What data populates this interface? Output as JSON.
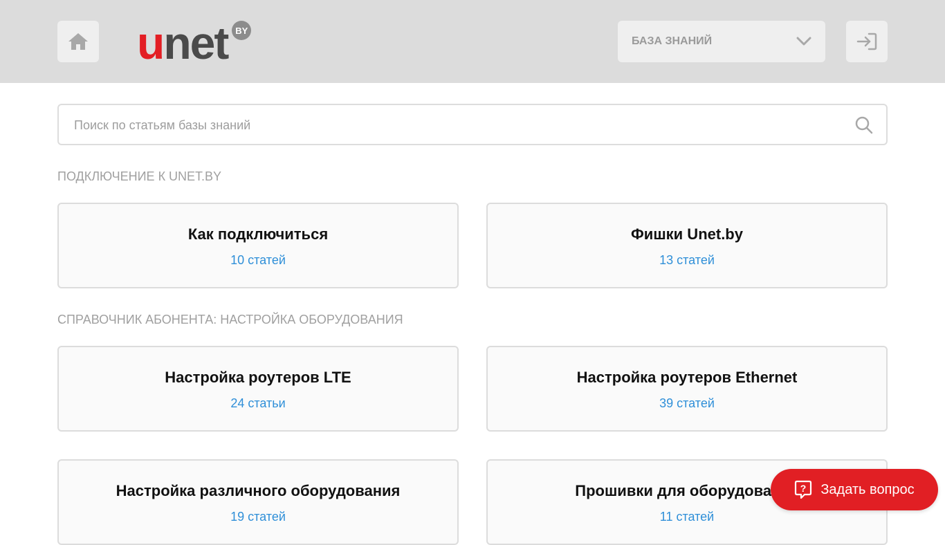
{
  "header": {
    "home_icon": "home-icon",
    "logo": {
      "part1": "u",
      "part2": "net",
      "badge": "BY",
      "colors": {
        "u": "#e31e24",
        "net": "#4a4a4a",
        "badge": "#8c8c8c"
      }
    },
    "kb_select_label": "БАЗА ЗНАНИЙ",
    "kb_select_icon": "chevron-down-icon",
    "login_icon": "login-icon"
  },
  "search": {
    "placeholder": "Поиск по статьям базы знаний",
    "value": "",
    "icon": "search-icon"
  },
  "sections": [
    {
      "title": "ПОДКЛЮЧЕНИЕ К UNET.BY",
      "cards": [
        {
          "title": "Как подключиться",
          "count": "10 статей"
        },
        {
          "title": "Фишки Unet.by",
          "count": "13 статей"
        }
      ]
    },
    {
      "title": "СПРАВОЧНИК АБОНЕНТА: НАСТРОЙКА ОБОРУДОВАНИЯ",
      "cards": [
        {
          "title": "Настройка роутеров LTE",
          "count": "24 статьи"
        },
        {
          "title": "Настройка роутеров Ethernet",
          "count": "39 статей"
        },
        {
          "title": "Настройка различного оборудования",
          "count": "19 статей"
        },
        {
          "title": "Прошивки для оборудования",
          "count": "11 статей"
        }
      ]
    }
  ],
  "ask_button": {
    "label": "Задать вопрос",
    "icon": "question-icon"
  },
  "colors": {
    "accent_red": "#e11f24",
    "link_blue": "#2f8fd8",
    "header_bg": "#dcdcdc"
  }
}
